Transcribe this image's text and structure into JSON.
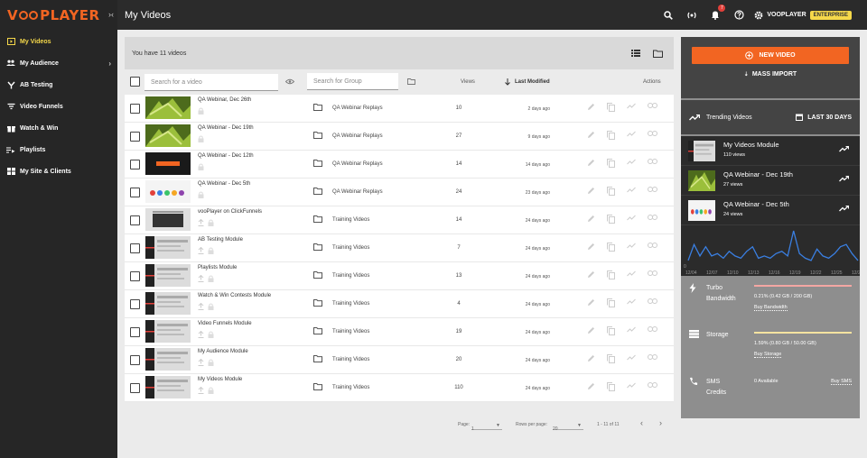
{
  "brand": {
    "logo_text_pre": "V",
    "logo_text_post": "PLAYER",
    "accent": "#f26522",
    "yellow": "#f5d84a"
  },
  "sidebar": {
    "collapse_label": "›‹",
    "items": [
      {
        "label": "My Videos"
      },
      {
        "label": "My Audience"
      },
      {
        "label": "AB Testing"
      },
      {
        "label": "Video Funnels"
      },
      {
        "label": "Watch & Win"
      },
      {
        "label": "Playlists"
      },
      {
        "label": "My Site & Clients"
      }
    ]
  },
  "topbar": {
    "title": "My Videos",
    "notification_count": "7",
    "account_name": "VOOPLAYER",
    "plan": "ENTERPRISE"
  },
  "videos": {
    "summary": "You have 11 videos",
    "search_placeholder": "Search for a video",
    "group_placeholder": "Search for Group",
    "headers": {
      "views": "Views",
      "modified": "Last Modified",
      "actions": "Actions"
    },
    "rows": [
      {
        "title": "QA Webinar, Dec 26th",
        "group": "QA Webinar Replays",
        "views": "10",
        "modified": "2 days ago"
      },
      {
        "title": "QA Webinar - Dec 19th",
        "group": "QA Webinar Replays",
        "views": "27",
        "modified": "9 days ago"
      },
      {
        "title": "QA Webinar - Dec 12th",
        "group": "QA Webinar Replays",
        "views": "14",
        "modified": "14 days ago"
      },
      {
        "title": "QA Webinar - Dec 5th",
        "group": "QA Webinar Replays",
        "views": "24",
        "modified": "23 days ago"
      },
      {
        "title": "vooPlayer on ClickFunnels",
        "group": "Training Videos",
        "views": "14",
        "modified": "24 days ago"
      },
      {
        "title": "AB Testing Module",
        "group": "Training Videos",
        "views": "7",
        "modified": "24 days ago"
      },
      {
        "title": "Playlists Module",
        "group": "Training Videos",
        "views": "13",
        "modified": "24 days ago"
      },
      {
        "title": "Watch & Win Contests Module",
        "group": "Training Videos",
        "views": "4",
        "modified": "24 days ago"
      },
      {
        "title": "Video Funnels Module",
        "group": "Training Videos",
        "views": "19",
        "modified": "24 days ago"
      },
      {
        "title": "My Audience Module",
        "group": "Training Videos",
        "views": "20",
        "modified": "24 days ago"
      },
      {
        "title": "My Videos Module",
        "group": "Training Videos",
        "views": "110",
        "modified": "24 days ago"
      }
    ],
    "pagination": {
      "page_label": "Page:",
      "page_value": "1",
      "rows_label": "Rows per page:",
      "rows_value": "20",
      "range": "1 - 11 of 11"
    }
  },
  "right": {
    "new_video": "NEW VIDEO",
    "mass_import": "MASS IMPORT",
    "trending_title": "Trending Videos",
    "period": "LAST 30 DAYS",
    "trending": [
      {
        "title": "My Videos Module",
        "views": "110 views"
      },
      {
        "title": "QA Webinar - Dec 19th",
        "views": "27 views"
      },
      {
        "title": "QA Webinar - Dec 5th",
        "views": "24 views"
      }
    ],
    "chart": {
      "ticks": [
        "12/04",
        "12/07",
        "12/10",
        "12/13",
        "12/16",
        "12/19",
        "12/22",
        "12/25",
        "12/28"
      ],
      "ymin_label": "0",
      "values": [
        2,
        9,
        4,
        8,
        4,
        5,
        3,
        6,
        4,
        3,
        6,
        8,
        3,
        4,
        3,
        5,
        6,
        4,
        15,
        5,
        3,
        2,
        7,
        4,
        3,
        5,
        8,
        9,
        5,
        2
      ]
    },
    "usage": [
      {
        "label1": "Turbo",
        "label2": "Bandwidth",
        "text": "0.21% (0.42 GB / 200 GB)",
        "link": "Buy Bandwidth",
        "fill_pct": 0.21,
        "color": "#f4a7a3"
      },
      {
        "label1": "Storage",
        "label2": "",
        "text": "1.59% (0.80 GB / 50.00 GB)",
        "link": "Buy Storage",
        "fill_pct": 1.59,
        "color": "#f5e3a0"
      },
      {
        "label1": "SMS",
        "label2": "Credits",
        "text": "0 Available",
        "link": "Buy SMS",
        "fill_pct": 0,
        "color": "#ffffff"
      }
    ]
  }
}
